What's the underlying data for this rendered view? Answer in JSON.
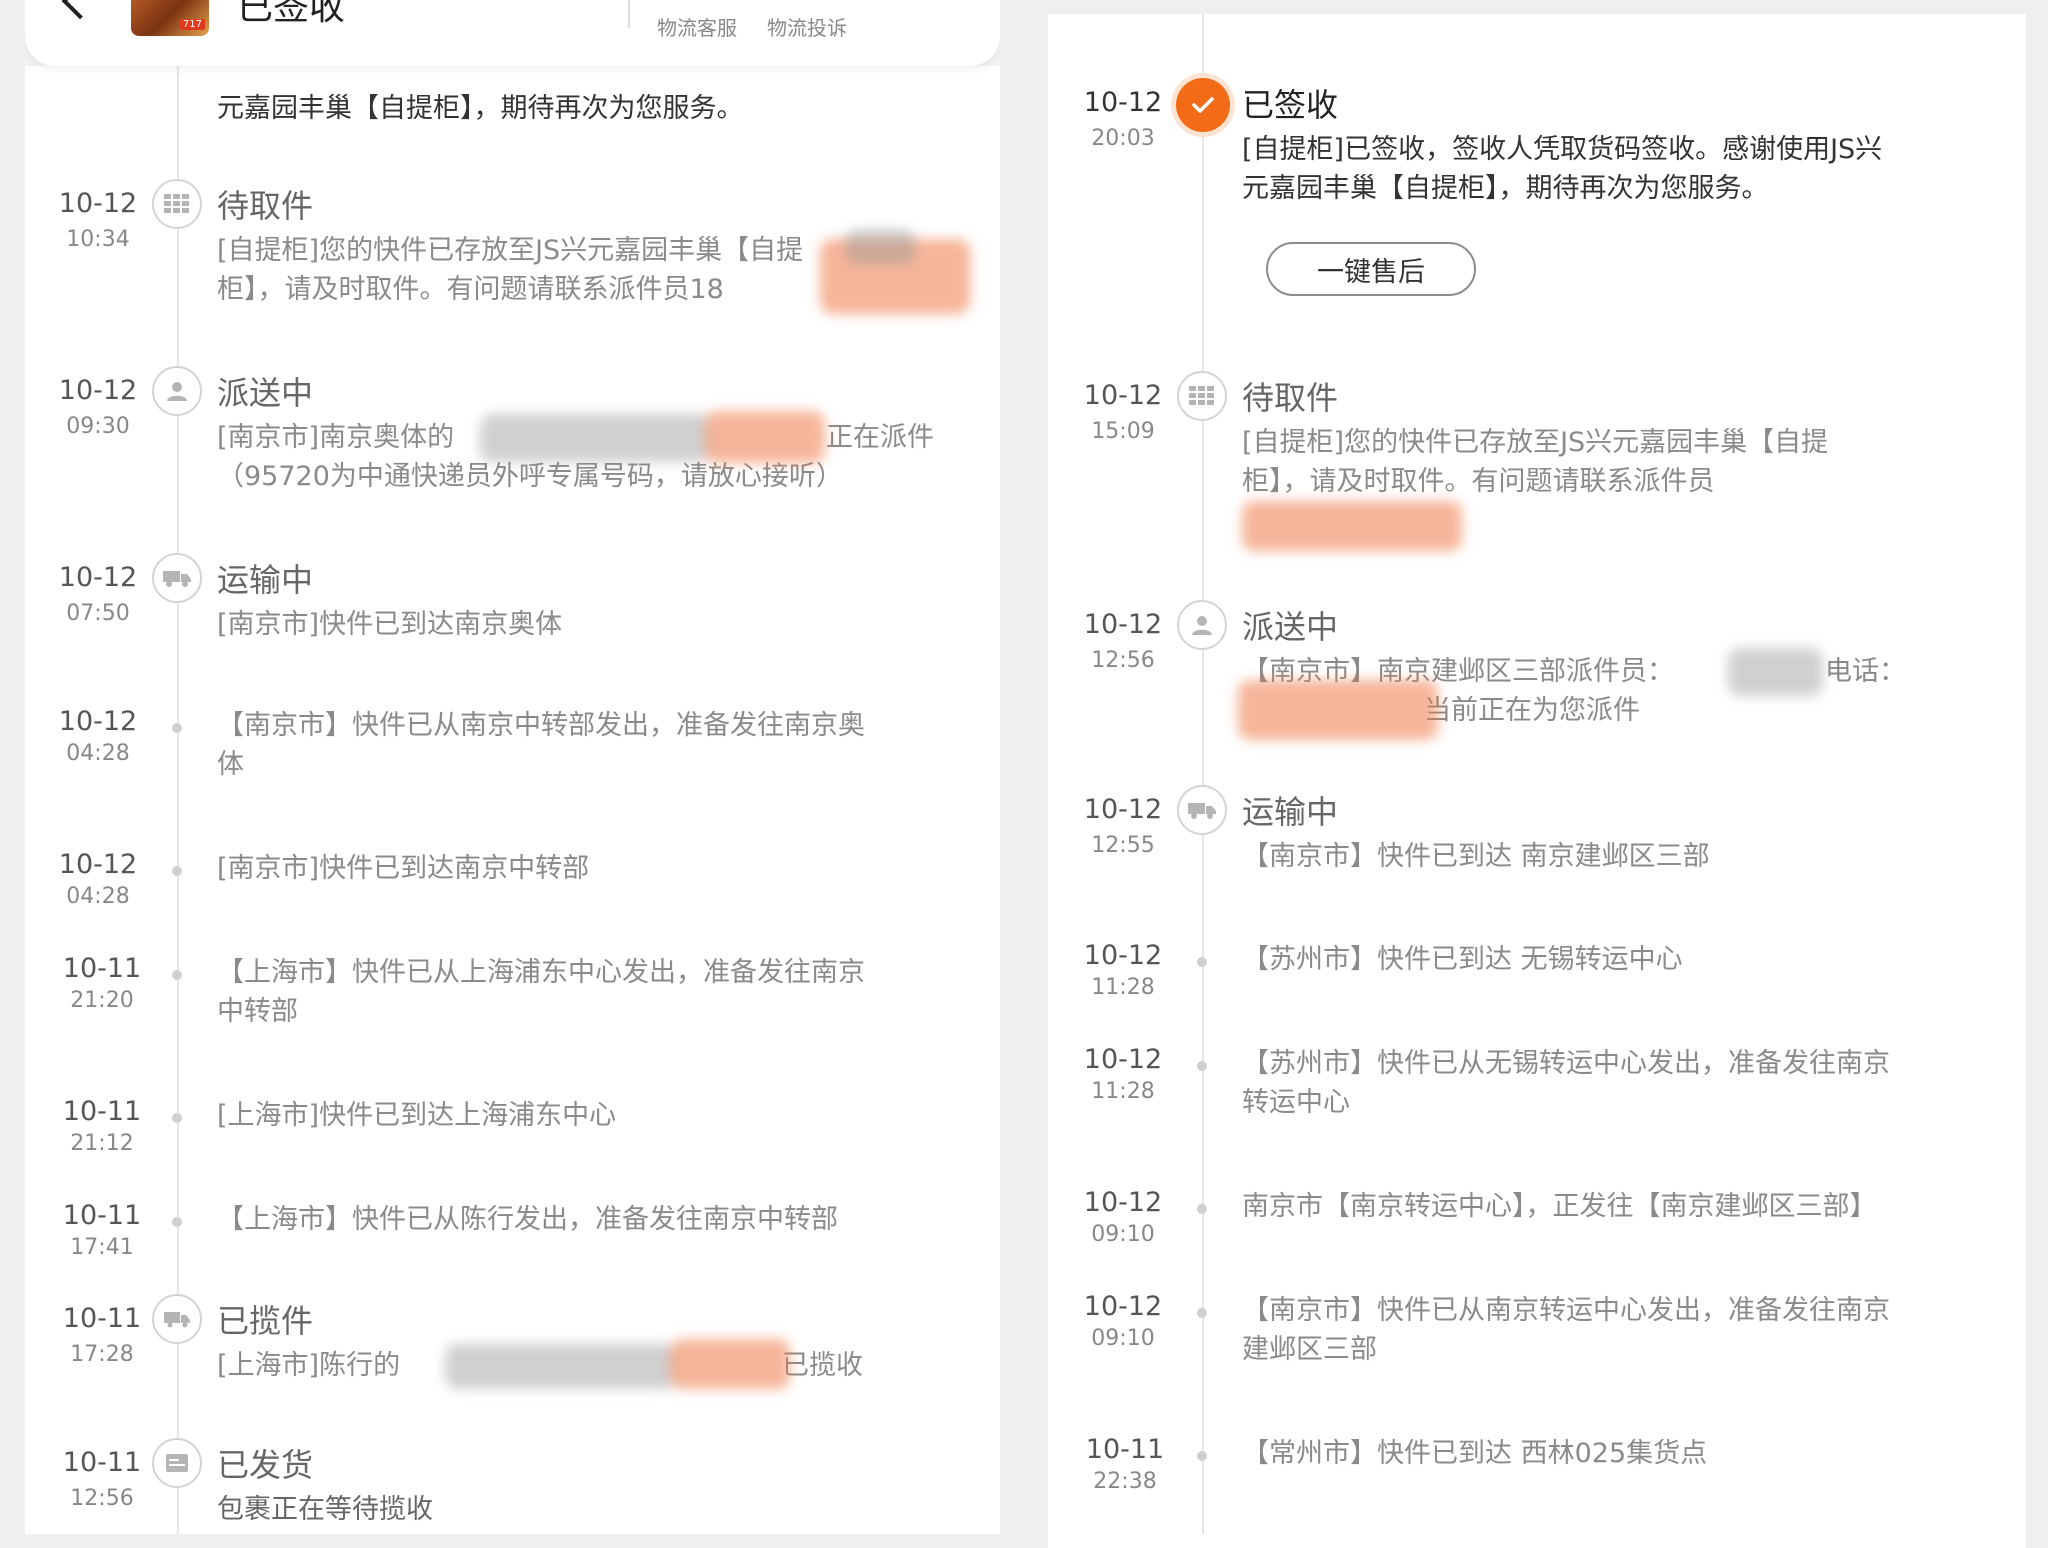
{
  "header": {
    "title": "已签收",
    "thumb_tag": "717",
    "links": [
      "物流客服",
      "物流投诉"
    ],
    "more": "···"
  },
  "left_timeline": {
    "top_fragment": "元嘉园丰巢【自提柜】，期待再次为您服务。",
    "events": [
      {
        "date": "10-12",
        "time": "10:34",
        "status": "待取件",
        "icon": "locker-icon",
        "detail": [
          "[自提柜]您的快件已存放至JS兴元嘉园丰巢【自提",
          "柜】，请及时取件。有问题请联系派件员18"
        ]
      },
      {
        "date": "10-12",
        "time": "09:30",
        "status": "派送中",
        "icon": "courier-icon",
        "detail": [
          "[南京市]南京奥体的",
          "正在派件",
          "（95720为中通快递员外呼专属号码，请放心接听）"
        ]
      },
      {
        "date": "10-12",
        "time": "07:50",
        "status": "运输中",
        "icon": "truck-icon",
        "detail": [
          "[南京市]快件已到达南京奥体"
        ]
      },
      {
        "date": "10-12",
        "time": "04:28",
        "status": "",
        "icon": "dot",
        "detail": [
          "【南京市】快件已从南京中转部发出，准备发往南京奥",
          "体"
        ]
      },
      {
        "date": "10-12",
        "time": "04:28",
        "status": "",
        "icon": "dot",
        "detail": [
          "[南京市]快件已到达南京中转部"
        ]
      },
      {
        "date": "10-11",
        "time": "21:20",
        "status": "",
        "icon": "dot",
        "detail": [
          "【上海市】快件已从上海浦东中心发出，准备发往南京",
          "中转部"
        ]
      },
      {
        "date": "10-11",
        "time": "21:12",
        "status": "",
        "icon": "dot",
        "detail": [
          "[上海市]快件已到达上海浦东中心"
        ]
      },
      {
        "date": "10-11",
        "time": "17:41",
        "status": "",
        "icon": "dot",
        "detail": [
          "【上海市】快件已从陈行发出，准备发往南京中转部"
        ]
      },
      {
        "date": "10-11",
        "time": "17:28",
        "status": "已揽件",
        "icon": "pickup-icon",
        "detail": [
          "[上海市]陈行的",
          "已揽收"
        ]
      },
      {
        "date": "10-11",
        "time": "12:56",
        "status": "已发货",
        "icon": "shipped-icon",
        "detail": [
          "包裹正在等待揽收"
        ]
      }
    ]
  },
  "right_timeline": {
    "events": [
      {
        "date": "10-12",
        "time": "20:03",
        "status": "已签收",
        "icon": "check-icon",
        "detail": [
          "[自提柜]已签收，签收人凭取货码签收。感谢使用JS兴",
          "元嘉园丰巢【自提柜】，期待再次为您服务。"
        ],
        "button": "一键售后"
      },
      {
        "date": "10-12",
        "time": "15:09",
        "status": "待取件",
        "icon": "locker-icon",
        "detail": [
          "[自提柜]您的快件已存放至JS兴元嘉园丰巢【自提",
          "柜】，请及时取件。有问题请联系派件员"
        ]
      },
      {
        "date": "10-12",
        "time": "12:56",
        "status": "派送中",
        "icon": "courier-icon",
        "detail": [
          "【南京市】南京建邺区三部派件员：",
          "电话：",
          "当前正在为您派件"
        ]
      },
      {
        "date": "10-12",
        "time": "12:55",
        "status": "运输中",
        "icon": "truck-icon",
        "detail": [
          "【南京市】快件已到达 南京建邺区三部"
        ]
      },
      {
        "date": "10-12",
        "time": "11:28",
        "status": "",
        "icon": "dot",
        "detail": [
          "【苏州市】快件已到达 无锡转运中心"
        ]
      },
      {
        "date": "10-12",
        "time": "11:28",
        "status": "",
        "icon": "dot",
        "detail": [
          "【苏州市】快件已从无锡转运中心发出，准备发往南京",
          "转运中心"
        ]
      },
      {
        "date": "10-12",
        "time": "09:10",
        "status": "",
        "icon": "dot",
        "detail": [
          "南京市【南京转运中心】，正发往【南京建邺区三部】"
        ]
      },
      {
        "date": "10-12",
        "time": "09:10",
        "status": "",
        "icon": "dot",
        "detail": [
          "【南京市】快件已从南京转运中心发出，准备发往南京",
          "建邺区三部"
        ]
      },
      {
        "date": "10-11",
        "time": "22:38",
        "status": "",
        "icon": "dot",
        "detail": [
          "【常州市】快件已到达 西林025集货点"
        ]
      }
    ]
  },
  "colors": {
    "accent": "#f36b16",
    "redact": "#ee7846"
  }
}
